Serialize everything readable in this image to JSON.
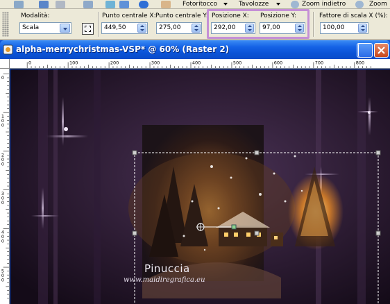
{
  "top_toolbar": {
    "fotoritocco_label": "Fotoritocco",
    "tavolozze_label": "Tavolozze",
    "zoom_indietro_label": "Zoom indietro",
    "zoom_label": "Zoom"
  },
  "options_bar": {
    "modalita_label": "Modalità:",
    "modalita_value": "Scala",
    "punto_centrale_x_label": "Punto centrale X:",
    "punto_centrale_x_value": "449,50",
    "punto_centrale_y_label": "Punto centrale Y:",
    "punto_centrale_y_value": "275,00",
    "posizione_x_label": "Posizione X:",
    "posizione_x_value": "292,00",
    "posizione_y_label": "Posizione Y:",
    "posizione_y_value": "97,00",
    "fattore_scala_label": "Fattore di scala X (%):",
    "fattore_scala_value": "100,00",
    "highlight_color": "#c58fd6"
  },
  "document_window": {
    "title": "alpha-merrychristmas-VSP* @  60% (Raster 2)",
    "ruler_top_ticks": [
      "0",
      "100",
      "200",
      "300",
      "400",
      "500",
      "600",
      "700",
      "800"
    ],
    "ruler_left_ticks": [
      "0",
      "1\n0\n0",
      "2\n0\n0",
      "3\n0\n0",
      "4\n0\n0",
      "5\n0\n0"
    ],
    "title_bar_color": "#0a52d6"
  },
  "artwork": {
    "signature": "Pinuccia",
    "website": "www.maidiregrafica.eu"
  }
}
